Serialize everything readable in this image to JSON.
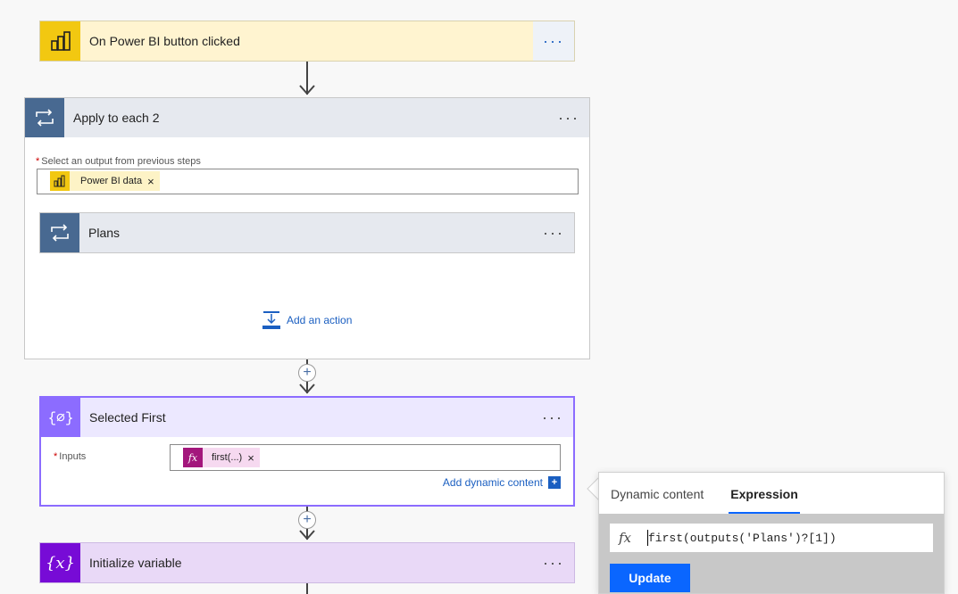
{
  "trigger": {
    "title": "On Power BI button clicked",
    "menu": "···"
  },
  "apply_each": {
    "title": "Apply to each 2",
    "menu": "···",
    "field_label": "Select an output from previous steps",
    "token_label": "Power BI data",
    "token_remove": "×",
    "inner": {
      "title": "Plans",
      "menu": "···"
    },
    "add_action": "Add an action"
  },
  "add_step": "+",
  "compose": {
    "title": "Selected First",
    "menu": "···",
    "inputs_label": "Inputs",
    "token_label": "first(...)",
    "token_remove": "×",
    "add_dynamic": "Add dynamic content",
    "add_dynamic_icon": "+"
  },
  "init_var": {
    "title": "Initialize variable",
    "menu": "···"
  },
  "panel": {
    "tabs": [
      {
        "label": "Dynamic content",
        "active": false
      },
      {
        "label": "Expression",
        "active": true
      }
    ],
    "fx_label": "fx",
    "expression": "first(outputs('Plans')?[1])",
    "update_label": "Update"
  },
  "colors": {
    "powerbi": "#f2c811",
    "loop": "#486991",
    "compose": "#8c6cff",
    "variable": "#770bd6",
    "accent": "#0a66ff"
  }
}
